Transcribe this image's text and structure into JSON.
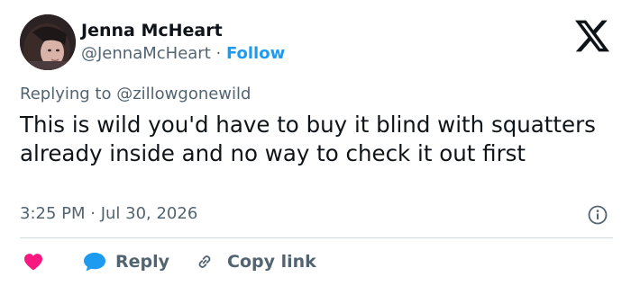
{
  "author": {
    "display_name": "Jenna McHeart",
    "handle": "@JennaMcHeart",
    "separator": " · ",
    "follow_label": "Follow"
  },
  "brand": {
    "logo_icon": "x-logo-icon"
  },
  "reply_context": {
    "prefix": "Replying to ",
    "mention": "@zillowgonewild"
  },
  "tweet": {
    "text": "This is wild you'd have to buy it blind with squatters already inside and no way to check it out first",
    "timestamp": "3:25 PM · Jul 30, 2026"
  },
  "actions": {
    "like_icon": "heart-icon",
    "reply_label": "Reply",
    "copy_link_label": "Copy link"
  },
  "colors": {
    "accent": "#1d9bf0",
    "like": "#f91880",
    "secondary_text": "#536471",
    "primary_text": "#0f1419",
    "divider": "#cfd9de"
  }
}
